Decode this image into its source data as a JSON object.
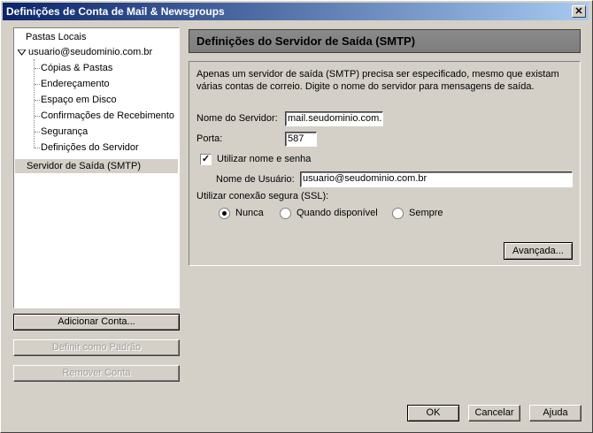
{
  "window": {
    "title": "Definições de Conta de Mail & Newsgroups",
    "close_label": "✕"
  },
  "tree": {
    "items": [
      {
        "label": "Pastas Locais"
      },
      {
        "label": "usuario@seudominio.com.br"
      },
      {
        "label": "Cópias & Pastas"
      },
      {
        "label": "Endereçamento"
      },
      {
        "label": "Espaço em Disco"
      },
      {
        "label": "Confirmações de Recebimento"
      },
      {
        "label": "Segurança"
      },
      {
        "label": "Definições do Servidor"
      },
      {
        "label": "Servidor de Saída (SMTP)"
      }
    ],
    "expander_icon": "triangle-down-icon"
  },
  "left_buttons": {
    "add_account": "Adicionar Conta...",
    "set_default": "Definir como Padrão",
    "remove_account": "Remover Conta"
  },
  "panel": {
    "header": "Definições do Servidor de Saída (SMTP)",
    "description_line1": "Apenas um servidor de saída (SMTP) precisa ser especificado, mesmo que existam",
    "description_line2": "várias contas de correio. Digite o nome do servidor para mensagens de saída.",
    "server_label": "Nome do Servidor:",
    "server_value": "mail.seudominio.com.br",
    "port_label": "Porta:",
    "port_value": "587",
    "use_auth_label": "Utilizar nome e senha",
    "use_auth_checked": "✓",
    "username_label": "Nome de Usuário:",
    "username_value": "usuario@seudominio.com.br",
    "ssl_label": "Utilizar conexão segura (SSL):",
    "ssl_options": [
      "Nunca",
      "Quando disponível",
      "Sempre"
    ],
    "advanced_button": "Avançada..."
  },
  "footer": {
    "ok": "OK",
    "cancel": "Cancelar",
    "help": "Ajuda"
  }
}
